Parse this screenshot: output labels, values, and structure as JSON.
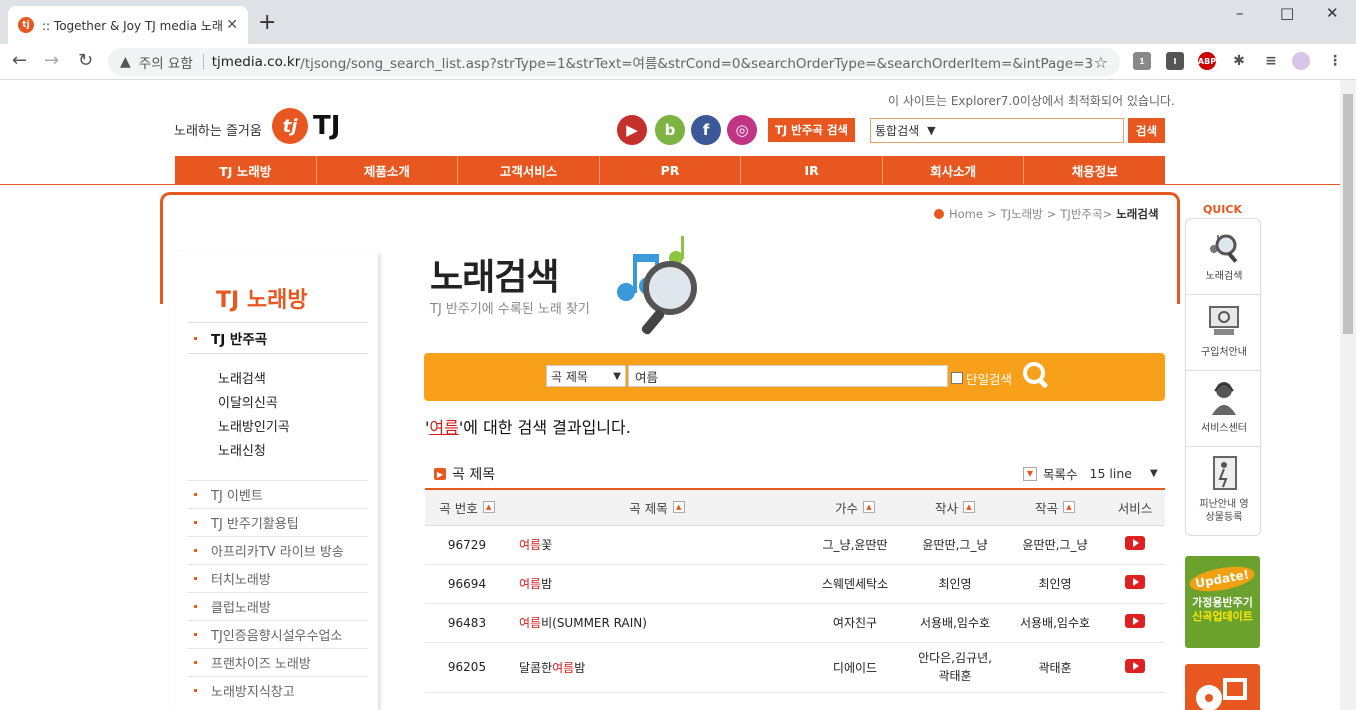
{
  "browser": {
    "tab_title": ":: Together & Joy TJ media 노래방",
    "new_tab": "+",
    "favicon": "tj",
    "minimize": "–",
    "maximize": "□",
    "close": "✕",
    "warning_text": "주의 요함",
    "url_host": "tjmedia.co.kr",
    "url_path": "/tjsong/song_search_list.asp?strType=1&strText=여름&strCond=0&searchOrderType=&searchOrderItem=&intPage=3",
    "ext_badge": "1",
    "ext_abp": "ABP"
  },
  "header": {
    "tagline": "노래하는 즐거움",
    "logo_mark": "tj",
    "logo_text": "TJ",
    "optimal_notice": "이 사이트는 Explorer7.0이상에서 최적화되어 있습니다.",
    "social": [
      "▶",
      "b",
      "f",
      "◎"
    ],
    "tj_search_button": "TJ 반주곡 검색",
    "search_select": "통합검색",
    "search_button": "검색"
  },
  "gnb": [
    "TJ 노래방",
    "제품소개",
    "고객서비스",
    "PR",
    "IR",
    "회사소개",
    "채용정보"
  ],
  "breadcrumb": {
    "home": "Home",
    "l1": "TJ노래방",
    "l2": "TJ반주곡",
    "current": "노래검색",
    "sep": ">"
  },
  "sidebar": {
    "title": "TJ 노래방",
    "section": "TJ 반주곡",
    "sub_items": [
      "노래검색",
      "이달의신곡",
      "노래방인기곡",
      "노래신청"
    ],
    "items": [
      "TJ 이벤트",
      "TJ 반주기활용팁",
      "아프리카TV 라이브 방송",
      "터치노래방",
      "클럽노래방",
      "TJ인증음향시설우수업소",
      "프랜차이즈 노래방",
      "노래방지식창고"
    ]
  },
  "heading": {
    "title": "노래검색",
    "subtitle": "TJ 반주기에 수록된 노래 찾기"
  },
  "search": {
    "field_select": "곡 제목",
    "keyword": "여름",
    "single_label": "단일검색"
  },
  "result": {
    "quote_open": "'",
    "keyword": "여름",
    "quote_close": "'",
    "message": "에 대한 검색 결과입니다."
  },
  "list": {
    "label": "곡 제목",
    "count_label": "목록수",
    "count_value": "15 line"
  },
  "table": {
    "headers": [
      "곡 번호",
      "곡 제목",
      "가수",
      "작사",
      "작곡",
      "서비스"
    ],
    "rows": [
      {
        "no": "96729",
        "pre": "",
        "kw": "여름",
        "post": "꽃",
        "singer": "그_냥,윤딴딴",
        "lyric": "윤딴딴,그_냥",
        "comp": "윤딴딴,그_냥"
      },
      {
        "no": "96694",
        "pre": "",
        "kw": "여름",
        "post": "밤",
        "singer": "스웨덴세탁소",
        "lyric": "최인영",
        "comp": "최인영"
      },
      {
        "no": "96483",
        "pre": "",
        "kw": "여름",
        "post": "비(SUMMER RAIN)",
        "singer": "여자친구",
        "lyric": "서용배,임수호",
        "comp": "서용배,임수호"
      },
      {
        "no": "96205",
        "pre": "달콤한",
        "kw": "여름",
        "post": "밤",
        "singer": "디에이드",
        "lyric": "안다은,김규년,곽태훈",
        "comp": "곽태훈"
      }
    ]
  },
  "quick": {
    "title": "QUICK",
    "items": [
      "노래검색",
      "구입처안내",
      "서비스센터",
      "피난안내 영상물등록"
    ],
    "update_badge": "Update!",
    "update_line1": "가정용반주기",
    "update_line2": "신곡업데이트"
  },
  "colors": {
    "brand": "#e8571f",
    "search_bar": "#f9a01a",
    "highlight": "#d21d1d"
  }
}
